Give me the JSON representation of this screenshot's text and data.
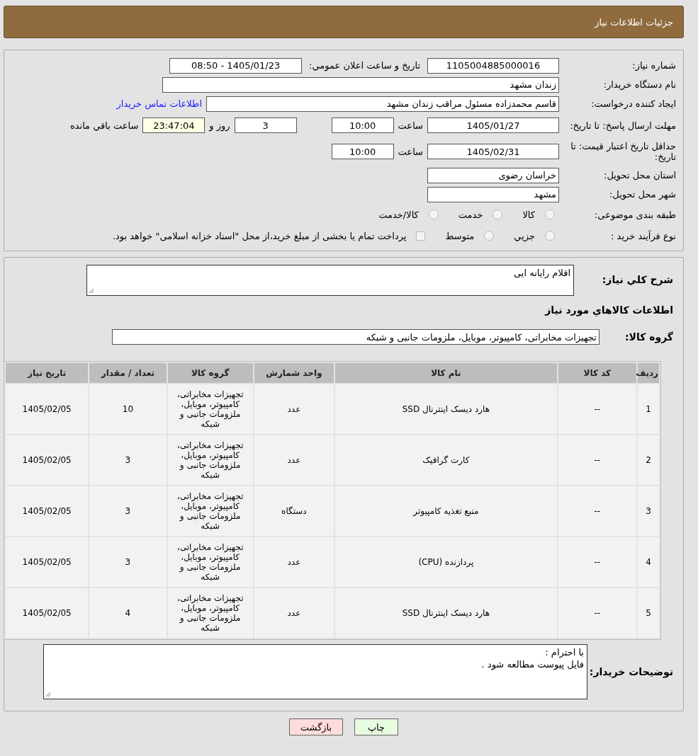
{
  "header": {
    "title": "جزئیات اطلاعات نیاز"
  },
  "need_number": {
    "label": "شماره نیاز:",
    "value": "1105004885000016"
  },
  "announce": {
    "label": "تاریخ و ساعت اعلان عمومي:",
    "value": "1405/01/23 - 08:50"
  },
  "buyer": {
    "label": "نام دستگاه خریدار:",
    "value": "زندان مشهد"
  },
  "creator": {
    "label": "ایجاد کننده درخواست:",
    "value": "قاسم محمدزاده مسئول مراقب زندان مشهد",
    "link": "اطلاعات تماس خریدار"
  },
  "deadline": {
    "label": "مهلت ارسال پاسخ: تا تاریخ:",
    "date": "1405/01/27",
    "time_label": "ساعت",
    "time": "10:00",
    "days": "3",
    "days_label": "روز و",
    "remaining": "23:47:04",
    "remaining_label": "ساعت باقي مانده"
  },
  "validity": {
    "label": "حداقل تاریخ اعتبار قیمت: تا تاریخ:",
    "date": "1405/02/31",
    "time_label": "ساعت",
    "time": "10:00"
  },
  "province": {
    "label": "استان محل تحویل:",
    "value": "خراسان رضوی"
  },
  "city": {
    "label": "شهر محل تحویل:",
    "value": "مشهد"
  },
  "category": {
    "label": "طبقه بندی موضوعی:",
    "options": [
      {
        "label": "کالا",
        "selected": false
      },
      {
        "label": "خدمت",
        "selected": false
      },
      {
        "label": "کالا/خدمت",
        "selected": false
      }
    ]
  },
  "process": {
    "label": "نوع فرآیند خرید :",
    "options": [
      {
        "label": "جزيي",
        "selected": false
      },
      {
        "label": "متوسط",
        "selected": false
      }
    ],
    "payment": {
      "label": "پرداخت تمام یا بخشی از مبلغ خرید،از محل \"اسناد خزانه اسلامی\" خواهد بود.",
      "checked": false
    }
  },
  "description": {
    "label": "شرح کلي نیاز:",
    "value": "اقلام رایانه ایی"
  },
  "goods_title": "اطلاعات کالاهاي مورد نیاز",
  "goods_group": {
    "label": "گروه کالا:",
    "value": "تجهیزات مخابراتی، کامپیوتر، موبایل، ملزومات جانبی و شبکه"
  },
  "table": {
    "columns": [
      "ردیف",
      "کد کالا",
      "نام کالا",
      "واحد شمارش",
      "گروه کالا",
      "تعداد / مقدار",
      "تاریخ نیاز"
    ],
    "rows": [
      [
        "1",
        "--",
        "هارد دیسک اینترنال SSD",
        "عدد",
        "تجهیزات مخابراتی، کامپیوتر، موبایل، ملزومات جانبی و شبکه",
        "10",
        "1405/02/05"
      ],
      [
        "2",
        "--",
        "کارت گرافیک",
        "عدد",
        "تجهیزات مخابراتی، کامپیوتر، موبایل، ملزومات جانبی و شبکه",
        "3",
        "1405/02/05"
      ],
      [
        "3",
        "--",
        "منبع تغذیه کامپیوتر",
        "دستگاه",
        "تجهیزات مخابراتی، کامپیوتر، موبایل، ملزومات جانبی و شبکه",
        "3",
        "1405/02/05"
      ],
      [
        "4",
        "--",
        "پردازنده (CPU)",
        "عدد",
        "تجهیزات مخابراتی، کامپیوتر، موبایل، ملزومات جانبی و شبکه",
        "3",
        "1405/02/05"
      ],
      [
        "5",
        "--",
        "هارد دیسک اینترنال SSD",
        "عدد",
        "تجهیزات مخابراتی، کامپیوتر، موبایل، ملزومات جانبی و شبکه",
        "4",
        "1405/02/05"
      ]
    ]
  },
  "notes": {
    "label": "توضیحات خریدار:",
    "lines": [
      "با احترام :",
      "فایل پیوست مطالعه شود ."
    ]
  },
  "buttons": [
    {
      "label": "چاپ",
      "kind": "print"
    },
    {
      "label": "بازگشت",
      "kind": "back"
    }
  ]
}
